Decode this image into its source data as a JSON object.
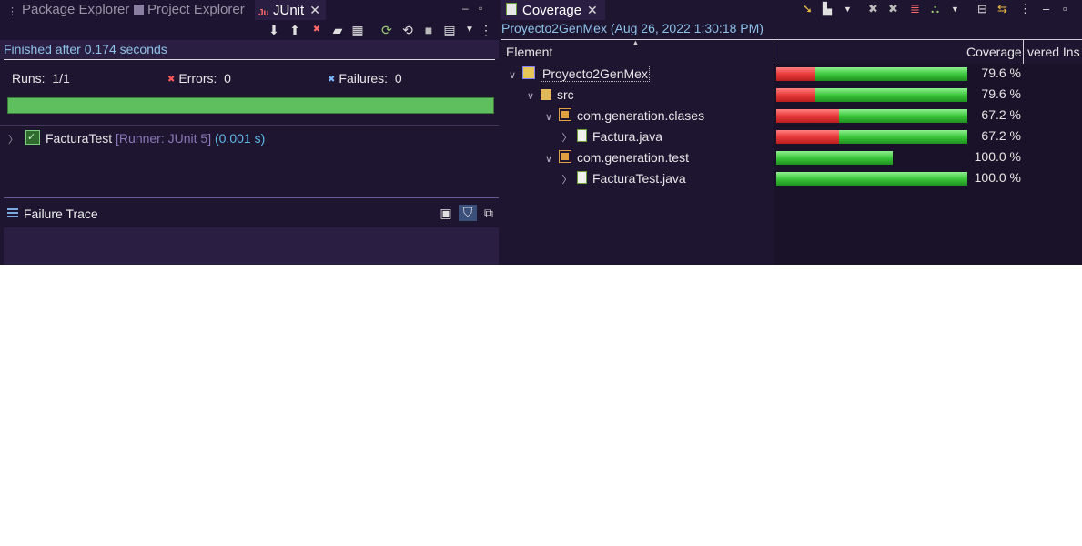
{
  "left_tabs": [
    {
      "label": "Package Explorer",
      "icon": "package-explorer-icon"
    },
    {
      "label": "Project Explorer",
      "icon": "project-explorer-icon"
    },
    {
      "label": "JUnit",
      "icon": "junit-icon"
    }
  ],
  "junit": {
    "status": "Finished after 0.174 seconds",
    "runs_label": "Runs:",
    "runs_value": "1/1",
    "errors_label": "Errors:",
    "errors_value": "0",
    "failures_label": "Failures:",
    "failures_value": "0",
    "progress": 1.0,
    "progress_color": "#5fbf5f",
    "test": {
      "name": "FacturaTest",
      "runner": "[Runner: JUnit 5]",
      "time": "(0.001 s)"
    },
    "failure_trace_label": "Failure Trace"
  },
  "coverage": {
    "tab_label": "Coverage",
    "session": "Proyecto2GenMex (Aug 26, 2022 1:30:18 PM)",
    "columns": {
      "element": "Element",
      "coverage": "Coverage",
      "covered": "vered Ins"
    },
    "rows": [
      {
        "label": "Proyecto2GenMex",
        "pct": "79.6 %",
        "covered_fraction": 0.796,
        "bar_extent": 1.0,
        "icon": "project-icon",
        "expanded": true,
        "selected": true
      },
      {
        "label": "src",
        "pct": "79.6 %",
        "covered_fraction": 0.796,
        "bar_extent": 1.0,
        "icon": "source-folder-icon",
        "expanded": true,
        "selected": false
      },
      {
        "label": "com.generation.clases",
        "pct": "67.2 %",
        "covered_fraction": 0.672,
        "bar_extent": 1.0,
        "icon": "package-icon",
        "expanded": true,
        "selected": false
      },
      {
        "label": "Factura.java",
        "pct": "67.2 %",
        "covered_fraction": 0.672,
        "bar_extent": 1.0,
        "icon": "java-file-icon",
        "expanded": false,
        "selected": false
      },
      {
        "label": "com.generation.test",
        "pct": "100.0 %",
        "covered_fraction": 1.0,
        "bar_extent": 0.61,
        "icon": "package-icon",
        "expanded": true,
        "selected": false
      },
      {
        "label": "FacturaTest.java",
        "pct": "100.0 %",
        "covered_fraction": 1.0,
        "bar_extent": 1.0,
        "icon": "java-file-icon",
        "expanded": false,
        "selected": false
      }
    ],
    "colors": {
      "covered": "#3cc83c",
      "missed": "#e83a3a"
    }
  }
}
